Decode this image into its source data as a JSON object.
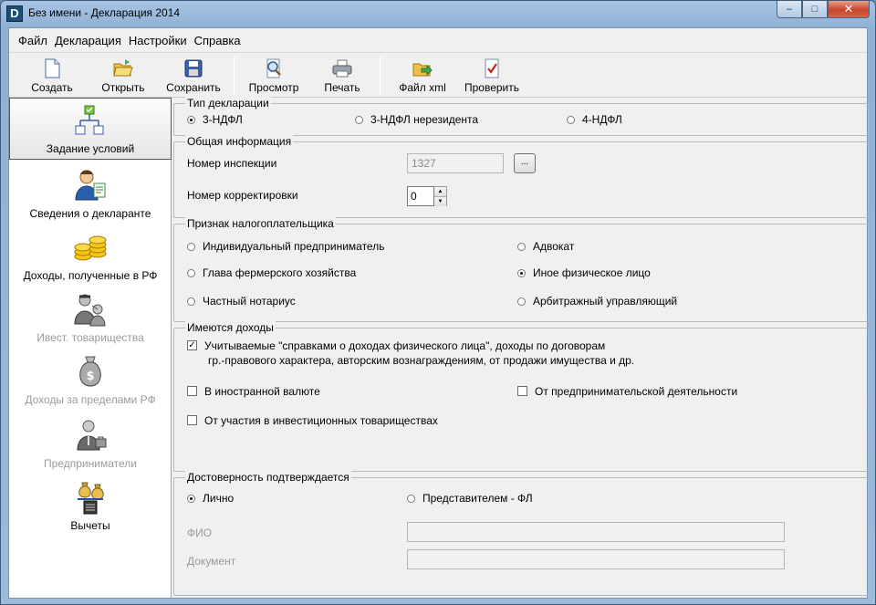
{
  "window": {
    "title": "Без имени - Декларация 2014",
    "app_icon_letter": "D",
    "minimize": "–",
    "maximize": "□",
    "close": "✕"
  },
  "menu": [
    "Файл",
    "Декларация",
    "Настройки",
    "Справка"
  ],
  "toolbar": {
    "create": "Создать",
    "open": "Открыть",
    "save": "Сохранить",
    "preview": "Просмотр",
    "print": "Печать",
    "xml": "Файл xml",
    "check": "Проверить"
  },
  "sidebar": {
    "items": [
      {
        "label": "Задание условий",
        "icon": "tree-structure-icon",
        "active": true,
        "disabled": false
      },
      {
        "label": "Сведения о декларанте",
        "icon": "person-icon",
        "active": false,
        "disabled": false
      },
      {
        "label": "Доходы, полученные в РФ",
        "icon": "coins-icon",
        "active": false,
        "disabled": false
      },
      {
        "label": "Ивест. товарищества",
        "icon": "partners-icon",
        "active": false,
        "disabled": true
      },
      {
        "label": "Доходы за пределами РФ",
        "icon": "money-bag-icon",
        "active": false,
        "disabled": true
      },
      {
        "label": "Предприниматели",
        "icon": "businessman-icon",
        "active": false,
        "disabled": true
      },
      {
        "label": "Вычеты",
        "icon": "deductions-icon",
        "active": false,
        "disabled": false
      }
    ]
  },
  "declaration_type": {
    "title": "Тип декларации",
    "options": [
      "3-НДФЛ",
      "3-НДФЛ нерезидента",
      "4-НДФЛ"
    ],
    "selected": 0
  },
  "general_info": {
    "title": "Общая информация",
    "inspection_label": "Номер инспекции",
    "inspection_value": "1327",
    "browse_label": "...",
    "correction_label": "Номер корректировки",
    "correction_value": "0"
  },
  "taxpayer": {
    "title": "Признак налогоплательщика",
    "options": [
      "Индивидуальный предприниматель",
      "Адвокат",
      "Глава фермерского хозяйства",
      "Иное физическое лицо",
      "Частный нотариус",
      "Арбитражный управляющий"
    ],
    "selected": 3
  },
  "income": {
    "title": "Имеются доходы",
    "main_line1": "Учитываемые \"справками о доходах физического лица\", доходы по договорам",
    "main_line2": "гр.-правового характера, авторским вознаграждениям, от продажи имущества и др.",
    "main_checked": true,
    "foreign": "В иностранной валюте",
    "business": "От предпринимательской деятельности",
    "investment": "От участия в инвестиционных товариществах",
    "check_mark": "✓"
  },
  "confirmation": {
    "title": "Достоверность подтверждается",
    "personally": "Лично",
    "representative": "Представителем - ФЛ",
    "selected": 0,
    "fio_label": "ФИО",
    "document_label": "Документ"
  }
}
